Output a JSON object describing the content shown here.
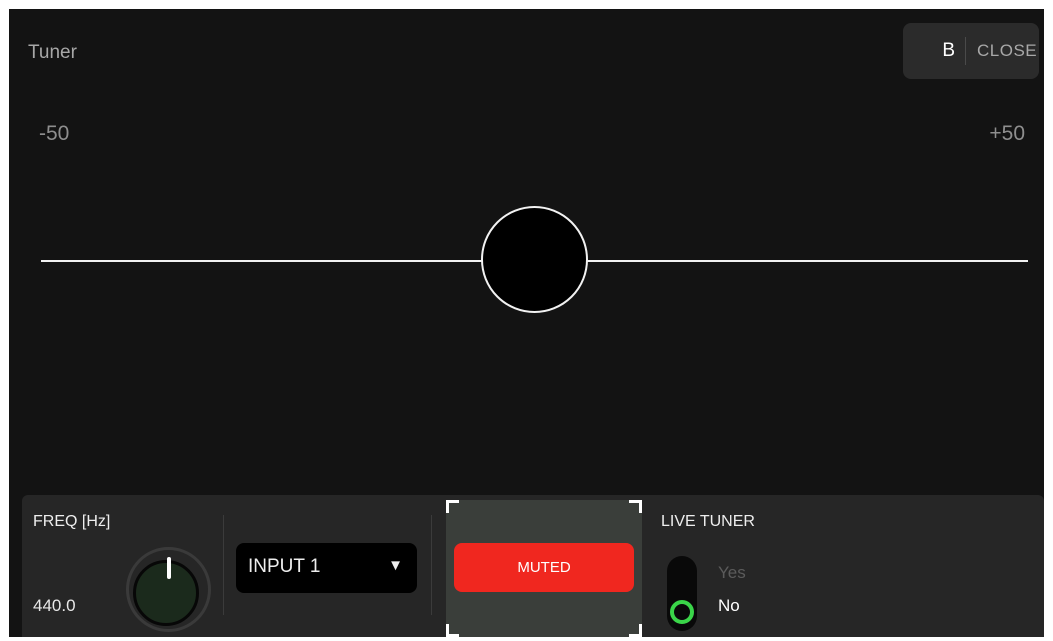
{
  "header": {
    "title": "Tuner",
    "badge": "B",
    "close_label": "CLOSE"
  },
  "meter": {
    "min_label": "-50",
    "max_label": "+50",
    "deviation_cents": 0
  },
  "controls": {
    "freq": {
      "label": "FREQ [Hz]",
      "value": "440.0",
      "knob_icon": "knob-icon"
    },
    "input_select": {
      "selected": "INPUT 1",
      "caret": "▼"
    },
    "mute": {
      "label": "MUTED",
      "color": "#f0271f"
    },
    "live_tuner": {
      "label": "LIVE TUNER",
      "options": [
        "Yes",
        "No"
      ],
      "selected": "No",
      "accent": "#3ad549"
    }
  }
}
